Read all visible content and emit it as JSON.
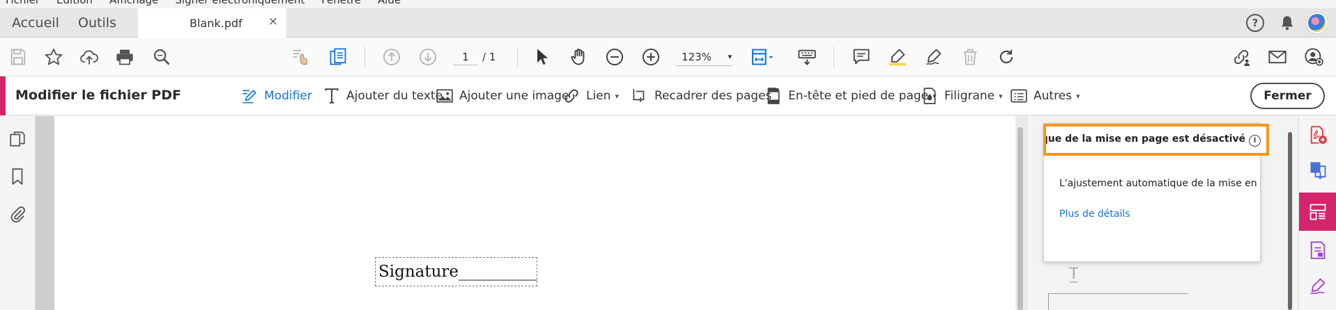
{
  "menu": {
    "items": [
      "Fichier",
      "Edition",
      "Affichage",
      "Signer électroniquement",
      "Fenêtre",
      "Aide"
    ]
  },
  "tabs": {
    "home": "Accueil",
    "tools": "Outils",
    "document": "Blank.pdf",
    "close_glyph": "×",
    "help_glyph": "?"
  },
  "toolbar": {
    "page_current": "1",
    "page_total": "/ 1",
    "zoom": "123%",
    "zoom_caret": "▾"
  },
  "editbar": {
    "title": "Modifier le fichier PDF",
    "modify": "Modifier",
    "add_text": "Ajouter du texte",
    "add_image": "Ajouter une image",
    "link": "Lien",
    "crop": "Recadrer des pages",
    "header_footer": "En-tête et pied de page",
    "watermark": "Filigrane",
    "more": "Autres",
    "dropdown_glyph": "▾",
    "close": "Fermer"
  },
  "document": {
    "signature_text": "Signature__________"
  },
  "tooltip": {
    "heading": "matique de la mise en page est désactivé",
    "info_glyph": "i",
    "body": "L'ajustement automatique de la mise en",
    "more_link": "Plus de détails"
  },
  "colors": {
    "accent_pink": "#d4246c",
    "link_blue": "#1473e6",
    "highlight_orange": "#f7941d"
  }
}
